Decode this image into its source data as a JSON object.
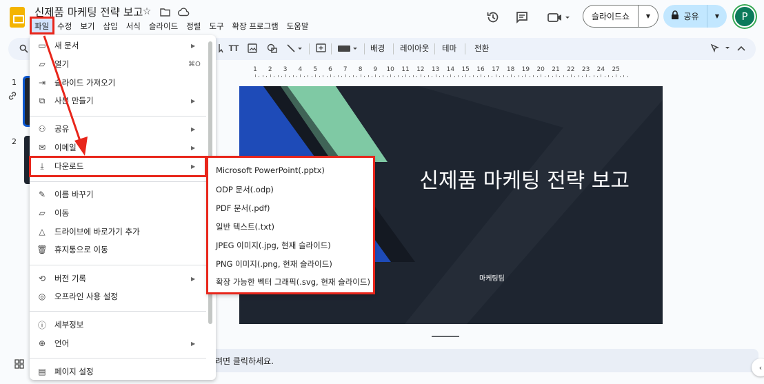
{
  "doc": {
    "title": "신제품 마케팅 전략 보고"
  },
  "menubar": [
    "파일",
    "수정",
    "보기",
    "삽입",
    "서식",
    "슬라이드",
    "정렬",
    "도구",
    "확장 프로그램",
    "도움말"
  ],
  "header": {
    "slideshow_label": "슬라이드쇼",
    "share_label": "공유",
    "avatar_letter": "P"
  },
  "toolbar": {
    "background_label": "배경",
    "layout_label": "레이아웃",
    "theme_label": "테마",
    "transition_label": "전환"
  },
  "ruler": {
    "labels": [
      "1",
      "2",
      "3",
      "4",
      "5",
      "6",
      "7",
      "8",
      "9",
      "10",
      "11",
      "12",
      "13",
      "14",
      "15",
      "16",
      "17",
      "18",
      "19",
      "20",
      "21",
      "22",
      "23",
      "24",
      "25"
    ]
  },
  "filmstrip": {
    "slide_numbers": [
      "1",
      "2"
    ]
  },
  "slide": {
    "title": "신제품 마케팅 전략 보고",
    "subtitle": "마케팅팀",
    "colors": {
      "background": "#1e2530",
      "blue": "#1e4bb8",
      "green": "#7fc9a4"
    }
  },
  "notes": {
    "placeholder": "려면 클릭하세요."
  },
  "file_menu": {
    "items": [
      {
        "label": "새 문서",
        "icon": "new-document-icon",
        "arrow": true
      },
      {
        "label": "열기",
        "icon": "folder-icon",
        "shortcut": "⌘O"
      },
      {
        "label": "슬라이드 가져오기",
        "icon": "import-icon"
      },
      {
        "label": "사본 만들기",
        "icon": "copy-icon",
        "arrow": true
      },
      {
        "label": "공유",
        "icon": "person-add-icon",
        "arrow": true
      },
      {
        "label": "이메일",
        "icon": "mail-icon",
        "arrow": true
      },
      {
        "label": "다운로드",
        "icon": "download-icon",
        "arrow": true
      },
      {
        "label": "이름 바꾸기",
        "icon": "rename-icon"
      },
      {
        "label": "이동",
        "icon": "move-folder-icon"
      },
      {
        "label": "드라이브에 바로가기 추가",
        "icon": "drive-shortcut-icon"
      },
      {
        "label": "휴지통으로 이동",
        "icon": "trash-icon"
      },
      {
        "label": "버전 기록",
        "icon": "history-icon",
        "arrow": true
      },
      {
        "label": "오프라인 사용 설정",
        "icon": "offline-icon"
      },
      {
        "label": "세부정보",
        "icon": "info-icon"
      },
      {
        "label": "언어",
        "icon": "globe-icon",
        "arrow": true
      },
      {
        "label": "페이지 설정",
        "icon": "page-setup-icon"
      }
    ]
  },
  "download_submenu": {
    "items": [
      "Microsoft PowerPoint(.pptx)",
      "ODP 문서(.odp)",
      "PDF 문서(.pdf)",
      "일반 텍스트(.txt)",
      "JPEG 이미지(.jpg, 현재 슬라이드)",
      "PNG 이미지(.png, 현재 슬라이드)",
      "확장 가능한 벡터 그래픽(.svg, 현재 슬라이드)"
    ]
  },
  "annotation_color": "#e8261b"
}
